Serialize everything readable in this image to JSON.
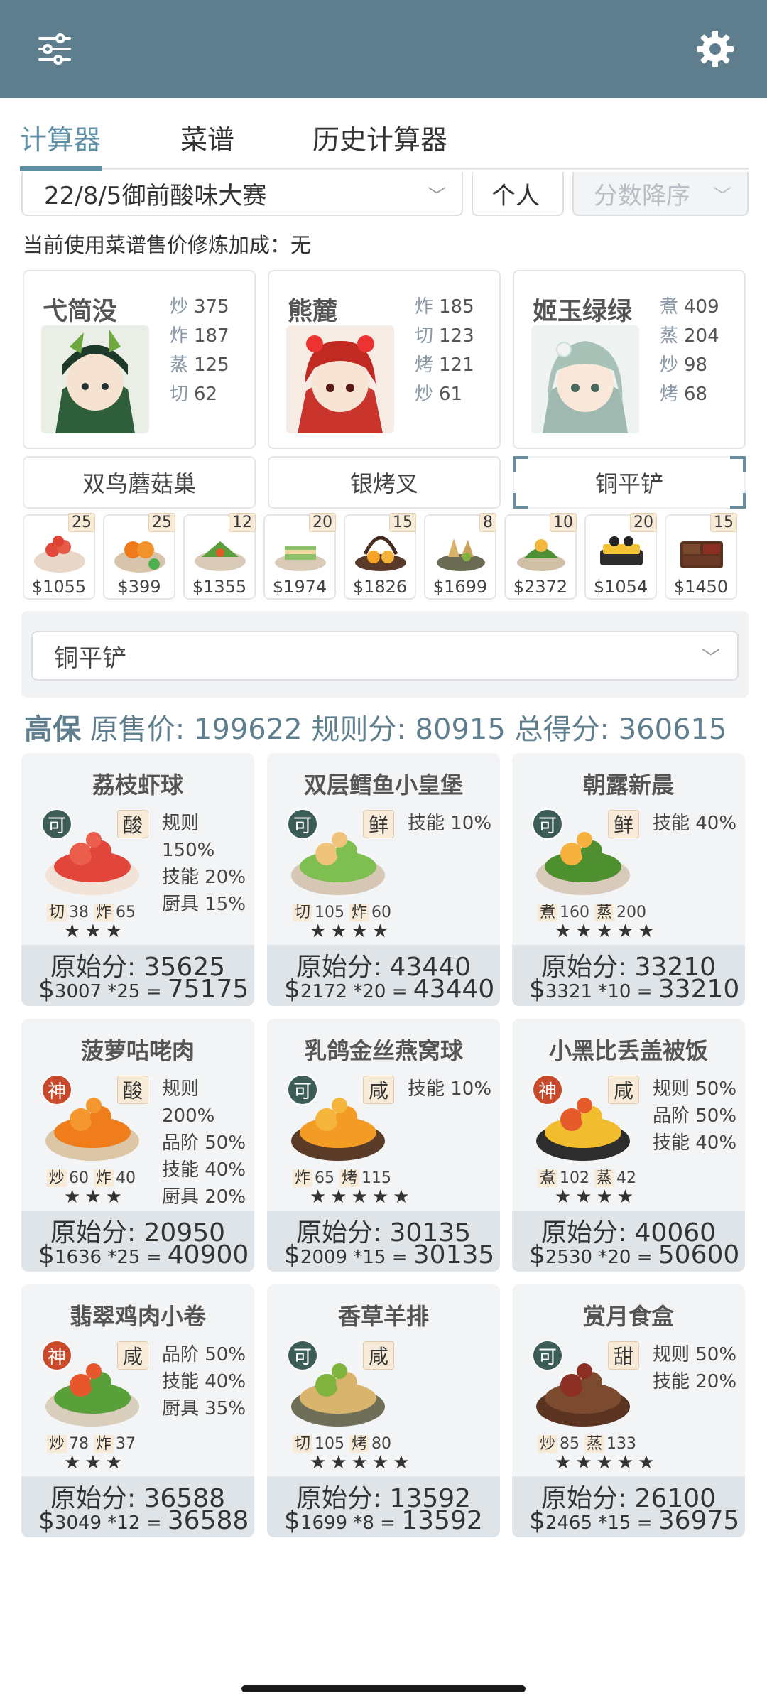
{
  "header": {
    "left_icon": "sliders-icon",
    "right_icon": "gear-icon"
  },
  "tabs": [
    {
      "label": "计算器"
    },
    {
      "label": "菜谱"
    },
    {
      "label": "历史计算器"
    }
  ],
  "selectors": {
    "contest": "22/8/5御前酸味大赛",
    "mode": "个人",
    "sort": "分数降序"
  },
  "bonus_text": "当前使用菜谱售价修炼加成：无",
  "chefs": [
    {
      "name": "弋简没",
      "skills": [
        {
          "k": "炒",
          "v": "375"
        },
        {
          "k": "炸",
          "v": "187"
        },
        {
          "k": "蒸",
          "v": "125"
        },
        {
          "k": "切",
          "v": "62"
        }
      ]
    },
    {
      "name": "熊麓",
      "skills": [
        {
          "k": "炸",
          "v": "185"
        },
        {
          "k": "切",
          "v": "123"
        },
        {
          "k": "烤",
          "v": "121"
        },
        {
          "k": "炒",
          "v": "61"
        }
      ]
    },
    {
      "name": "姬玉绿绿",
      "skills": [
        {
          "k": "煮",
          "v": "409"
        },
        {
          "k": "蒸",
          "v": "204"
        },
        {
          "k": "炒",
          "v": "98"
        },
        {
          "k": "烤",
          "v": "68"
        }
      ]
    }
  ],
  "equipment": [
    "双鸟蘑菇巢",
    "银烤叉",
    "铜平铲"
  ],
  "dish_icons": [
    {
      "qty": "25",
      "price": "$1055"
    },
    {
      "qty": "25",
      "price": "$399"
    },
    {
      "qty": "12",
      "price": "$1355"
    },
    {
      "qty": "20",
      "price": "$1974"
    },
    {
      "qty": "15",
      "price": "$1826"
    },
    {
      "qty": "8",
      "price": "$1699"
    },
    {
      "qty": "10",
      "price": "$2372"
    },
    {
      "qty": "20",
      "price": "$1054"
    },
    {
      "qty": "15",
      "price": "$1450"
    }
  ],
  "equip_dropdown": "铜平铲",
  "summary": {
    "label": "高保",
    "orig_label": "原售价:",
    "orig": "199622",
    "rule_label": "规则分:",
    "rule": "80915",
    "total_label": "总得分:",
    "total": "360615"
  },
  "recipes": [
    {
      "title": "荔枝虾球",
      "badge": "可",
      "flavor": "酸",
      "rules": [
        "规则 150%",
        "技能 20%",
        "厨具 15%"
      ],
      "skills": [
        {
          "k": "切",
          "v": "38"
        },
        {
          "k": "炸",
          "v": "65"
        }
      ],
      "stars": "★★★",
      "raw": "原始分: 35625",
      "price": "3007",
      "mult": "*25",
      "total": "75175"
    },
    {
      "title": "双层鳕鱼小皇堡",
      "badge": "可",
      "flavor": "鲜",
      "rules": [
        "技能 10%"
      ],
      "skills": [
        {
          "k": "切",
          "v": "105"
        },
        {
          "k": "炸",
          "v": "60"
        }
      ],
      "stars": "★★★★",
      "raw": "原始分: 43440",
      "price": "2172",
      "mult": "*20",
      "total": "43440"
    },
    {
      "title": "朝露新晨",
      "badge": "可",
      "flavor": "鲜",
      "rules": [
        "技能 40%"
      ],
      "skills": [
        {
          "k": "煮",
          "v": "160"
        },
        {
          "k": "蒸",
          "v": "200"
        }
      ],
      "stars": "★★★★★",
      "raw": "原始分: 33210",
      "price": "3321",
      "mult": "*10",
      "total": "33210"
    },
    {
      "title": "菠萝咕咾肉",
      "badge": "神",
      "flavor": "酸",
      "rules": [
        "规则 200%",
        "品阶 50%",
        "技能 40%",
        "厨具 20%"
      ],
      "skills": [
        {
          "k": "炒",
          "v": "60"
        },
        {
          "k": "炸",
          "v": "40"
        }
      ],
      "stars": "★★★",
      "raw": "原始分: 20950",
      "price": "1636",
      "mult": "*25",
      "total": "40900"
    },
    {
      "title": "乳鸽金丝燕窝球",
      "badge": "可",
      "flavor": "咸",
      "rules": [
        "技能 10%"
      ],
      "skills": [
        {
          "k": "炸",
          "v": "65"
        },
        {
          "k": "烤",
          "v": "115"
        }
      ],
      "stars": "★★★★★",
      "raw": "原始分: 30135",
      "price": "2009",
      "mult": "*15",
      "total": "30135"
    },
    {
      "title": "小黑比丢盖被饭",
      "badge": "神",
      "flavor": "咸",
      "rules": [
        "规则 50%",
        "品阶 50%",
        "技能 40%"
      ],
      "skills": [
        {
          "k": "煮",
          "v": "102"
        },
        {
          "k": "蒸",
          "v": "42"
        }
      ],
      "stars": "★★★★",
      "raw": "原始分: 40060",
      "price": "2530",
      "mult": "*20",
      "total": "50600"
    },
    {
      "title": "翡翠鸡肉小卷",
      "badge": "神",
      "flavor": "咸",
      "rules": [
        "品阶 50%",
        "技能 40%",
        "厨具 35%"
      ],
      "skills": [
        {
          "k": "炒",
          "v": "78"
        },
        {
          "k": "炸",
          "v": "37"
        }
      ],
      "stars": "★★★",
      "raw": "原始分: 36588",
      "price": "3049",
      "mult": "*12",
      "total": "36588"
    },
    {
      "title": "香草羊排",
      "badge": "可",
      "flavor": "咸",
      "rules": [],
      "skills": [
        {
          "k": "切",
          "v": "105"
        },
        {
          "k": "烤",
          "v": "80"
        }
      ],
      "stars": "★★★★★",
      "raw": "原始分: 13592",
      "price": "1699",
      "mult": "*8",
      "total": "13592"
    },
    {
      "title": "赏月食盒",
      "badge": "可",
      "flavor": "甜",
      "rules": [
        "规则 50%",
        "技能 20%"
      ],
      "skills": [
        {
          "k": "炒",
          "v": "85"
        },
        {
          "k": "蒸",
          "v": "133"
        }
      ],
      "stars": "★★★★★",
      "raw": "原始分: 26100",
      "price": "2465",
      "mult": "*15",
      "total": "36975"
    }
  ]
}
